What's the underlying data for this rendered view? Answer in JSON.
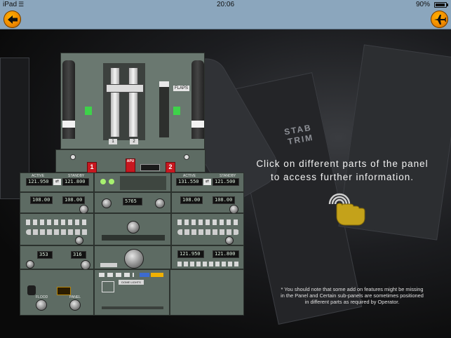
{
  "status_bar": {
    "carrier": "iPad",
    "wifi_icon": "wifi-icon",
    "time": "20:06",
    "battery_percent": "90%",
    "battery_icon": "battery-icon"
  },
  "nav_bar": {
    "back_icon": "arrow-left-icon",
    "menu_icon": "airplane-icon",
    "accent_color": "#f08a00",
    "bar_color": "#8ba6bd"
  },
  "background": {
    "label_stab": "STAB",
    "label_trim": "TRIM"
  },
  "panel": {
    "throttle_labels": {
      "flaps": "FLAPS",
      "fuel_1": "1",
      "fuel_2": "2"
    },
    "fire_tags": {
      "engine_1": "1",
      "apu": "APU",
      "engine_2": "2"
    },
    "radio_left": {
      "active": "121.950",
      "standby": "121.800"
    },
    "radio_right": {
      "active": "131.550",
      "standby": "121.500"
    },
    "nav_left": {
      "active": "108.00",
      "standby": "108.00"
    },
    "nav_right": {
      "active": "108.00",
      "standby": "108.00"
    },
    "transponder": "5765",
    "adf": {
      "left": "353",
      "right": "316"
    },
    "radio_lower_right": {
      "active": "121.950",
      "standby": "121.800"
    },
    "labels": {
      "active": "ACTIVE",
      "standby": "STANDBY",
      "flood": "FLOOD",
      "panel": "PANEL",
      "dome_lights": "DOME LIGHTS"
    }
  },
  "instruction": {
    "line1": "Click on different parts of the panel",
    "line2": "to access further information."
  },
  "hand_icon": "tap-hand-icon",
  "footnote": {
    "line1": "* You should note that some add on features might be missing",
    "line2": "in the Panel and Certain sub-panels are sometimes positioned",
    "line3": "in different parts as required by Operator."
  }
}
